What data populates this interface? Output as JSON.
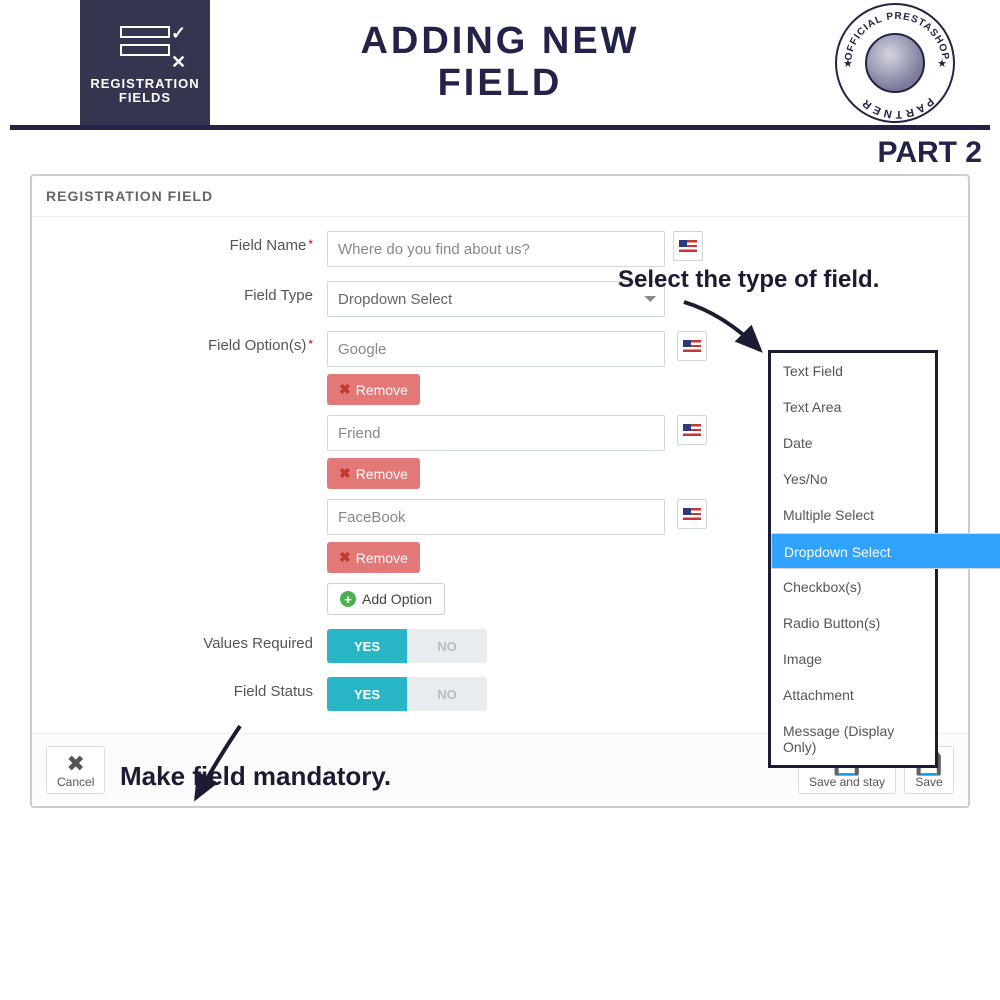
{
  "banner": {
    "title_line1": "ADDING NEW",
    "title_line2": "FIELD",
    "left_caption1": "REGISTRATION",
    "left_caption2": "FIELDS",
    "partner_top": "OFFICIAL PRESTASHOP",
    "partner_bottom": "PARTNER"
  },
  "part_label": "PART 2",
  "panel": {
    "heading": "REGISTRATION FIELD",
    "field_name": {
      "label": "Field Name",
      "value": "Where do you find about us?"
    },
    "field_type": {
      "label": "Field Type",
      "value": "Dropdown Select"
    },
    "options": {
      "label": "Field Option(s)",
      "items": [
        {
          "value": "Google",
          "remove": "Remove"
        },
        {
          "value": "Friend",
          "remove": "Remove"
        },
        {
          "value": "FaceBook",
          "remove": "Remove"
        }
      ],
      "add_label": "Add Option"
    },
    "values_required": {
      "label": "Values Required",
      "yes": "YES",
      "no": "NO",
      "value": true
    },
    "field_status": {
      "label": "Field Status",
      "yes": "YES",
      "no": "NO",
      "value": true
    },
    "footer": {
      "cancel": "Cancel",
      "save_stay": "Save and stay",
      "save": "Save"
    }
  },
  "dropdown_types": [
    "Text Field",
    "Text Area",
    "Date",
    "Yes/No",
    "Multiple Select",
    "Dropdown Select",
    "Checkbox(s)",
    "Radio Button(s)",
    "Image",
    "Attachment",
    "Message (Display Only)"
  ],
  "dropdown_selected_index": 5,
  "annotations": {
    "select_type": "Select the type of field.",
    "mandatory": "Make field mandatory."
  }
}
